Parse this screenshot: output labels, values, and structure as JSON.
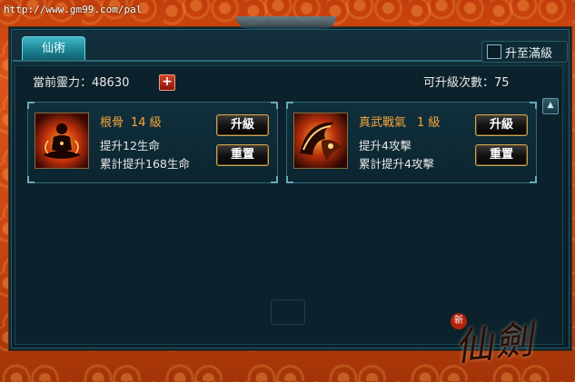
{
  "browser": {
    "url": "http://www.gm99.com/pal"
  },
  "tabs": [
    {
      "label": "仙術"
    }
  ],
  "max_toggle": {
    "label": "升至滿級",
    "checked": false
  },
  "stats": {
    "power_label": "當前靈力：",
    "power_value": "48630",
    "upgrades_label": "可升級次數：",
    "upgrades_value": "75"
  },
  "skills": [
    {
      "name": "根骨",
      "level": "14 級",
      "effect": "提升12生命",
      "cumulative": "累計提升168生命",
      "upgrade_label": "升級",
      "reset_label": "重置"
    },
    {
      "name": "真武戰氣",
      "level": "1 級",
      "effect": "提升4攻擊",
      "cumulative": "累計提升4攻擊",
      "upgrade_label": "升級",
      "reset_label": "重置"
    }
  ],
  "logo": {
    "badge": "新",
    "text": "仙劍"
  },
  "colors": {
    "frame": "#c94613",
    "panel": "#0b212b",
    "accent_gold": "#f5a53a",
    "tab": "#1a7f90"
  }
}
